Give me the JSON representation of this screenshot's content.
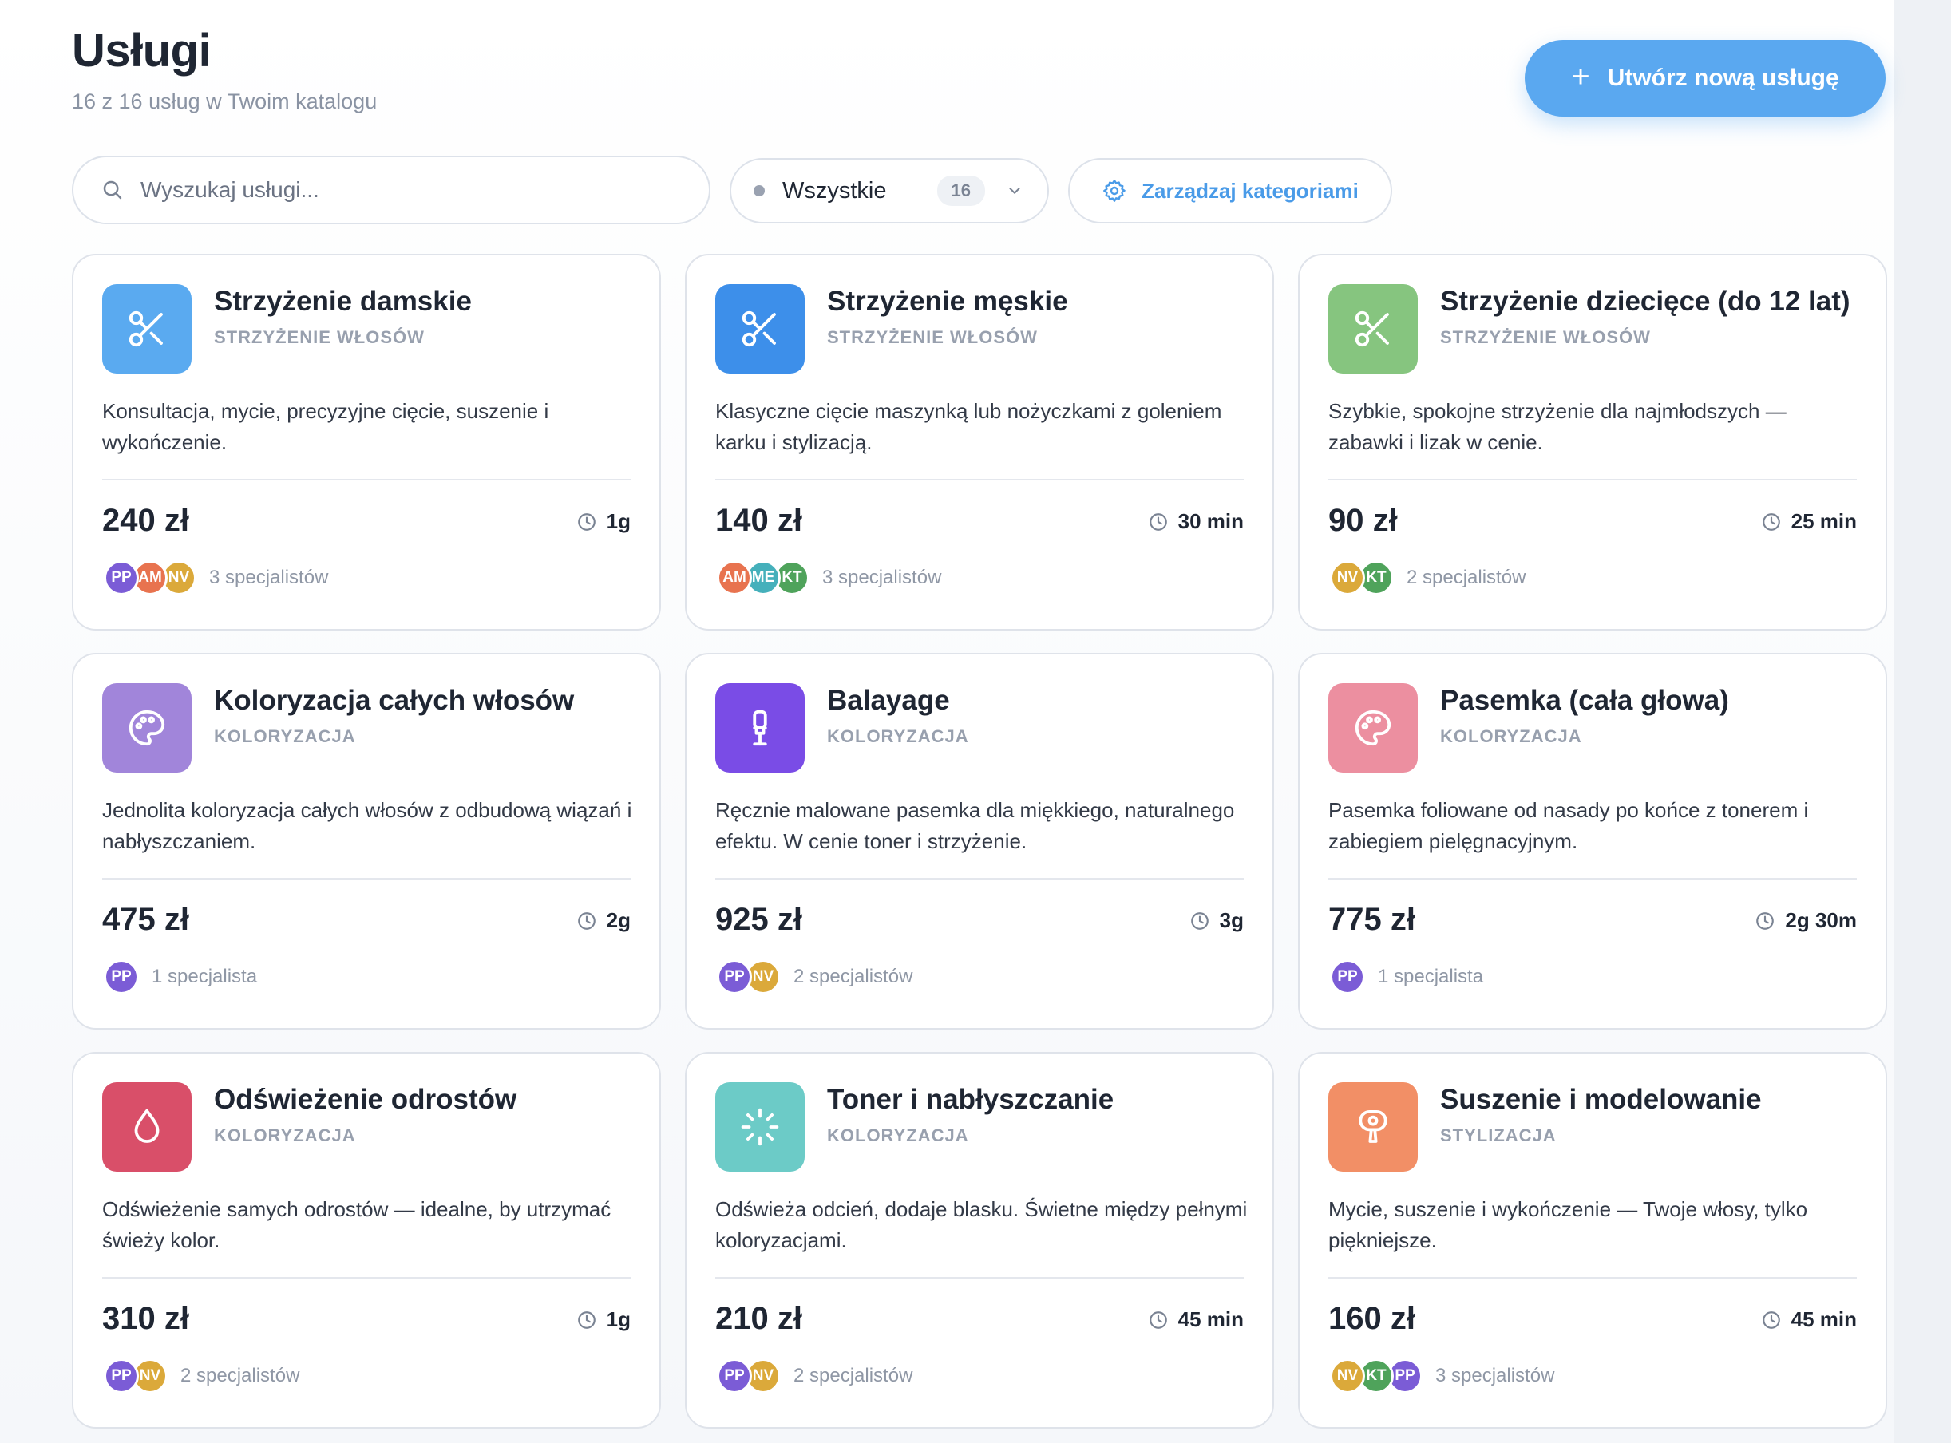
{
  "header": {
    "title": "Usługi",
    "subtitle": "16 z 16 usług w Twoim katalogu",
    "create_button": "Utwórz nową usługę"
  },
  "toolbar": {
    "search_placeholder": "Wyszukaj usługi...",
    "filter_label": "Wszystkie",
    "filter_count": "16",
    "manage_label": "Zarządzaj kategoriami"
  },
  "colors": {
    "accent": "#5aa8f0",
    "link": "#4a9be8"
  },
  "avatar_colors": {
    "PP": "#7b5cd6",
    "AM": "#e8734f",
    "NV": "#dba93a",
    "ME": "#45b0bb",
    "KT": "#4fa35b"
  },
  "services": [
    {
      "name": "Strzyżenie damskie",
      "category": "Strzyżenie włosów",
      "description": "Konsultacja, mycie, precyzyjne cięcie, suszenie i wykończenie.",
      "price": "240 zł",
      "duration": "1g",
      "icon": "scissors-icon",
      "color": "#5aaaf0",
      "specialists": [
        "PP",
        "AM",
        "NV"
      ],
      "specialists_label": "3 specjalistów"
    },
    {
      "name": "Strzyżenie męskie",
      "category": "Strzyżenie włosów",
      "description": "Klasyczne cięcie maszynką lub nożyczkami z goleniem karku i stylizacją.",
      "price": "140 zł",
      "duration": "30 min",
      "icon": "scissors-icon",
      "color": "#3d8fea",
      "specialists": [
        "AM",
        "ME",
        "KT"
      ],
      "specialists_label": "3 specjalistów"
    },
    {
      "name": "Strzyżenie dziecięce (do 12 lat)",
      "category": "Strzyżenie włosów",
      "description": "Szybkie, spokojne strzyżenie dla najmłodszych — zabawki i lizak w cenie.",
      "price": "90 zł",
      "duration": "25 min",
      "icon": "scissors-icon",
      "color": "#86c57f",
      "specialists": [
        "NV",
        "KT"
      ],
      "specialists_label": "2 specjalistów"
    },
    {
      "name": "Koloryzacja całych włosów",
      "category": "Koloryzacja",
      "description": "Jednolita koloryzacja całych włosów z odbudową wiązań i nabłyszczaniem.",
      "price": "475 zł",
      "duration": "2g",
      "icon": "palette-icon",
      "color": "#a185da",
      "specialists": [
        "PP"
      ],
      "specialists_label": "1 specjalista"
    },
    {
      "name": "Balayage",
      "category": "Koloryzacja",
      "description": "Ręcznie malowane pasemka dla miękkiego, naturalnego efektu. W cenie toner i strzyżenie.",
      "price": "925 zł",
      "duration": "3g",
      "icon": "brush-icon",
      "color": "#7a4ce6",
      "specialists": [
        "PP",
        "NV"
      ],
      "specialists_label": "2 specjalistów"
    },
    {
      "name": "Pasemka (cała głowa)",
      "category": "Koloryzacja",
      "description": "Pasemka foliowane od nasady po końce z tonerem i zabiegiem pielęgnacyjnym.",
      "price": "775 zł",
      "duration": "2g 30m",
      "icon": "palette-icon",
      "color": "#ec8fa0",
      "specialists": [
        "PP"
      ],
      "specialists_label": "1 specjalista"
    },
    {
      "name": "Odświeżenie odrostów",
      "category": "Koloryzacja",
      "description": "Odświeżenie samych odrostów — idealne, by utrzymać świeży kolor.",
      "price": "310 zł",
      "duration": "1g",
      "icon": "droplet-icon",
      "color": "#d94f69",
      "specialists": [
        "PP",
        "NV"
      ],
      "specialists_label": "2 specjalistów"
    },
    {
      "name": "Toner i nabłyszczanie",
      "category": "Koloryzacja",
      "description": "Odświeża odcień, dodaje blasku. Świetne między pełnymi koloryzacjami.",
      "price": "210 zł",
      "duration": "45 min",
      "icon": "sparkle-icon",
      "color": "#6ccbc7",
      "specialists": [
        "PP",
        "NV"
      ],
      "specialists_label": "2 specjalistów"
    },
    {
      "name": "Suszenie i modelowanie",
      "category": "Stylizacja",
      "description": "Mycie, suszenie i wykończenie — Twoje włosy, tylko piękniejsze.",
      "price": "160 zł",
      "duration": "45 min",
      "icon": "hair-dryer-icon",
      "color": "#f28f66",
      "specialists": [
        "NV",
        "KT",
        "PP"
      ],
      "specialists_label": "3 specjalistów"
    }
  ]
}
